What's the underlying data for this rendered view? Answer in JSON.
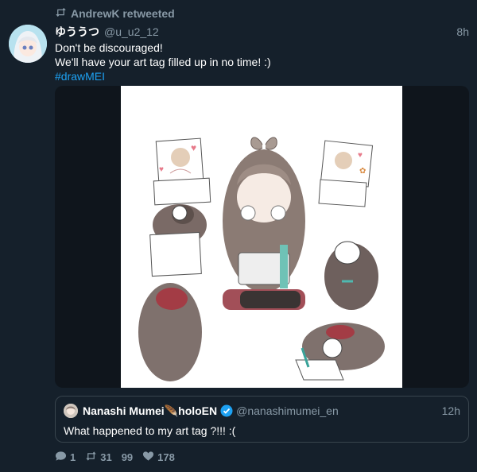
{
  "retweet": {
    "label": "AndrewK retweeted",
    "icon": "retweet-icon"
  },
  "tweet": {
    "display_name": "ゆううつ",
    "handle": "@u_u2_12",
    "time": "8h",
    "lines": [
      "Don't be discouraged!",
      "We'll have your art tag filled up in no time! :)"
    ],
    "hashtag": "#drawMEI"
  },
  "quote": {
    "display_name": "Nanashi Mumei",
    "feather_emoji": "🪶",
    "affiliation": "holoEN",
    "handle": "@nanashimumei_en",
    "time": "12h",
    "text": "What happened to my art tag ?!!! :(",
    "verified_icon": "verified-icon"
  },
  "actions": {
    "reply_count": "1",
    "retweet_count": "31",
    "quote_label": "99",
    "like_count": "178"
  },
  "colors": {
    "background": "#15202b",
    "muted": "#8899a6",
    "link": "#1da1f2",
    "border": "#38444d"
  }
}
